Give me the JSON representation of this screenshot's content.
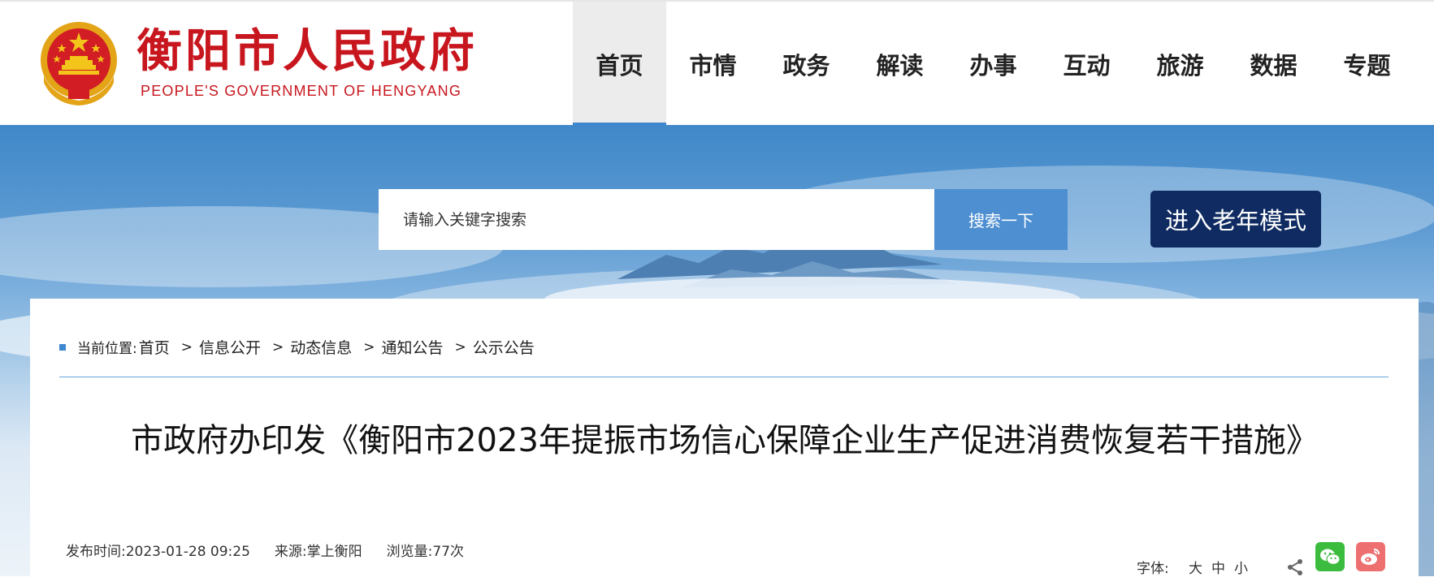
{
  "header": {
    "site_title": "衡阳市人民政府",
    "site_subtitle": "PEOPLE'S GOVERNMENT OF HENGYANG",
    "nav": [
      {
        "label": "首页",
        "active": true
      },
      {
        "label": "市情"
      },
      {
        "label": "政务"
      },
      {
        "label": "解读"
      },
      {
        "label": "办事"
      },
      {
        "label": "互动"
      },
      {
        "label": "旅游"
      },
      {
        "label": "数据"
      },
      {
        "label": "专题"
      }
    ]
  },
  "search": {
    "placeholder": "请输入关键字搜索",
    "button_label": "搜索一下"
  },
  "elder_mode_label": "进入老年模式",
  "breadcrumb": {
    "label": "当前位置:",
    "items": [
      "首页",
      "信息公开",
      "动态信息",
      "通知公告",
      "公示公告"
    ],
    "separator": ">"
  },
  "article": {
    "title": "市政府办印发《衡阳市2023年提振市场信心保障企业生产促进消费恢复若干措施》",
    "meta": {
      "publish_time": "发布时间:2023-01-28 09:25",
      "source": "来源:掌上衡阳",
      "views": "浏览量:77次"
    }
  },
  "tools": {
    "font_label": "字体:",
    "font_options": [
      "大",
      "中",
      "小"
    ]
  },
  "colors": {
    "brand_red": "#c8161e",
    "nav_active_bar": "#3e88d2",
    "search_button": "#4e8fd1",
    "elder_button": "#0f2b62",
    "wechat": "#3bbc3e",
    "weibo": "#ee6f6f"
  }
}
